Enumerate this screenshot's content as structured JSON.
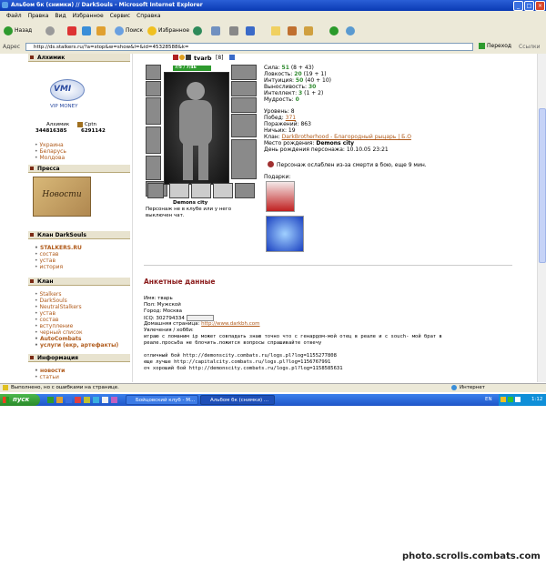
{
  "window": {
    "title": "Альбом бк (снимки) // DarkSouls - Microsoft Internet Explorer",
    "min": "_",
    "max": "□",
    "close": "×"
  },
  "menu": [
    "Файл",
    "Правка",
    "Вид",
    "Избранное",
    "Сервис",
    "Справка"
  ],
  "toolbar": {
    "back": "Назад",
    "search": "Поиск",
    "favorites": "Избранное"
  },
  "address": {
    "label": "Адрес",
    "url": "http://ds.stalkers.ru/?a=stop&w=show&l=&id=45328588&k=",
    "go": "Переход",
    "links": "Ссылки"
  },
  "sidebar": {
    "alchemist_head": "Алхимик",
    "vip": "VIP MONEY",
    "alch_name": "Алхимик",
    "alch_cpts": "Cptn",
    "alch_num1": "344816385",
    "alch_num2": "6291142",
    "countries": [
      "Украина",
      "Беларусь",
      "Молдова"
    ],
    "press_head": "Пресса",
    "news_img": "Новости",
    "clan_head": "Клан DarkSouls",
    "clan_items": [
      "STALKERS.RU",
      "состав",
      "устав",
      "история"
    ],
    "clan2_head": "Клан",
    "clan2_items": [
      "Stalkers",
      "DarkSouls",
      "NeutralStalkers",
      "устав",
      "состав",
      "вступление",
      "черный список",
      "AutoCombats",
      "услуги (екр, артефакты)"
    ],
    "info_head": "Информация",
    "info_items": [
      "новости",
      "статьи"
    ]
  },
  "character": {
    "name": "tvarb",
    "level": "[8]",
    "hp": "7/5 / 7/46",
    "city": "Demons city",
    "status": "Персонаж не в клубе или у него выключен чат.",
    "stats": [
      {
        "label": "Сила:",
        "value": "51",
        "extra": "(8 + 43)"
      },
      {
        "label": "Ловкость:",
        "value": "20",
        "extra": "(19 + 1)"
      },
      {
        "label": "Интуиция:",
        "value": "50",
        "extra": "(40 + 10)"
      },
      {
        "label": "Выносливость:",
        "value": "30",
        "extra": ""
      },
      {
        "label": "Интеллект:",
        "value": "3",
        "extra": "(1 + 2)"
      },
      {
        "label": "Мудрость:",
        "value": "0",
        "extra": ""
      }
    ],
    "info": [
      {
        "label": "Уровень:",
        "value": "8"
      },
      {
        "label": "Побед:",
        "value": "371"
      },
      {
        "label": "Поражений:",
        "value": "863"
      },
      {
        "label": "Ничьих:",
        "value": "19"
      },
      {
        "label": "Клан:",
        "value": "DarkBrotherhood - Благородный рыцарь | Б.О"
      },
      {
        "label": "Место рождения:",
        "value": "Demons city"
      },
      {
        "label": "День рождения персонажа:",
        "value": "10.10.05 23:21"
      }
    ],
    "weak": "Персонаж ослаблен из-за смерти в бою, еще 9 мин.",
    "gifts": "Подарки:"
  },
  "anketa": {
    "title": "Анкетные данные",
    "name": "Имя: тварь",
    "sex": "Пол: Мужской",
    "city": "Город: Москва",
    "icq": "ICQ: 302794334",
    "home_label": "Домашняя страница:",
    "home_url": "http://www.darkbh.com",
    "hobby_label": "Увлечения / хобби:",
    "lines": [
      "играю с ломаним ip может совпадать знаю точно что с генардом-мой отец в реале и с souch- мой брат в",
      "реале.просьба не блочить.пожится вопросы спрашивайте отвечу",
      "",
      "отличный бой http://demonscity.combats.ru/logs.pl?log=1155277808",
      "еще лучше http://capitalcity.combats.ru/logs.pl?log=1156767991",
      "оч хороший бой http://demonscity.combats.ru/logs.pl?log=1158585631"
    ]
  },
  "status": {
    "text": "Выполнено, но с ошибками на странице.",
    "zone": "Интернет"
  },
  "taskbar": {
    "start": "пуск",
    "tasks": [
      "Бойцовский клуб - M...",
      "Альбом бк (снимки) ..."
    ],
    "lang": "EN",
    "clock": "1:12"
  },
  "watermark": "photo.scrolls.combats.com"
}
